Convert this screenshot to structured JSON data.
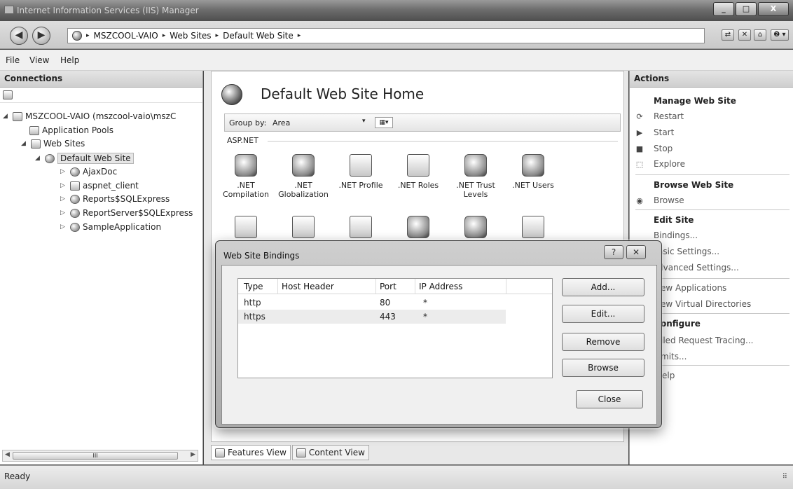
{
  "window": {
    "title": "Internet Information Services (IIS) Manager",
    "caption_buttons": [
      "_",
      "□",
      "X"
    ]
  },
  "address": {
    "back": "◀",
    "forward": "▶",
    "crumbs": [
      "MSZCOOL-VAIO",
      "Web Sites",
      "Default Web Site"
    ],
    "separator": "▸",
    "help_label": "❷ ▾"
  },
  "menu": {
    "file": "File",
    "view": "View",
    "help": "Help"
  },
  "connections": {
    "title": "Connections",
    "tree": {
      "server": "MSZCOOL-VAIO (mszcool-vaio\\mszC",
      "app_pools": "Application Pools",
      "web_sites": "Web Sites",
      "default_site": "Default Web Site",
      "children": [
        "AjaxDoc",
        "aspnet_client",
        "Reports$SQLExpress",
        "ReportServer$SQLExpress",
        "SampleApplication"
      ]
    },
    "scroll_thumb": "III",
    "expand_open": "◢",
    "expand_closed": "▷"
  },
  "center": {
    "title": "Default Web Site Home",
    "group_by_label": "Group by:",
    "group_by_value": "Area",
    "group_dropdown": "▾",
    "view_icon": "▦▾",
    "section": "ASP.NET",
    "features_row1": [
      ".NET Compilation",
      ".NET Globalization",
      ".NET Profile",
      ".NET Roles",
      ".NET Trust Levels",
      ".NET Users"
    ],
    "features_view": "Features View",
    "content_view": "Content View"
  },
  "actions": {
    "title": "Actions",
    "manage_head": "Manage Web Site",
    "restart": "Restart",
    "start": "Start",
    "stop": "Stop",
    "explore": "Explore",
    "browse_head": "Browse Web Site",
    "browse": "Browse",
    "edit_head": "Edit Site",
    "bindings": "Bindings...",
    "basic": "asic Settings...",
    "advanced": "dvanced Settings...",
    "view_apps": "ew Applications",
    "view_vdirs": "ew Virtual Directories",
    "configure_head": "onfigure",
    "failed_tracing": "iled Request Tracing...",
    "limits": "mits...",
    "help": "elp",
    "icons": {
      "restart": "⟳",
      "start": "▶",
      "stop": "■",
      "explore": "⬚",
      "browse": "◉"
    }
  },
  "status": {
    "text": "Ready",
    "grip": "⠿"
  },
  "dialog": {
    "title": "Web Site Bindings",
    "help_btn": "?",
    "close_btn": "✕",
    "columns": [
      "Type",
      "Host Header",
      "Port",
      "IP Address"
    ],
    "rows": [
      {
        "type": "http",
        "host": "",
        "port": "80",
        "ip": "*"
      },
      {
        "type": "https",
        "host": "",
        "port": "443",
        "ip": "*"
      }
    ],
    "buttons": {
      "add": "Add...",
      "edit": "Edit...",
      "remove": "Remove",
      "browse": "Browse",
      "close": "Close"
    }
  }
}
